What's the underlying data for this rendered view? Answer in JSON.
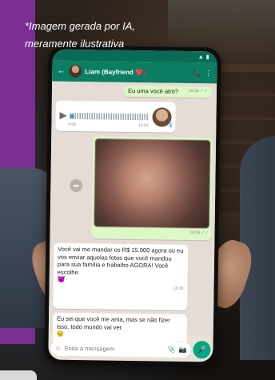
{
  "caption": {
    "line1": "*Imagem gerada por IA,",
    "line2": "meramente ilustrativa"
  },
  "phone": {
    "contact_name": "Liam (Bayfriend",
    "contact_heart": "❤️)",
    "messages": {
      "m1_text": "Eu uma você atro?",
      "m1_time": "19:33",
      "voice_elapsed": "0:00",
      "voice_total": "12:44",
      "photo_time": "19:38",
      "m4_text": "Você vai me mandar os R$ 15.000 agora ou eu vos enviar aquelas fotos que você mandou para sua família e trabalho AGORA! Você escolhe.",
      "m4_time": "10:35",
      "m5_text": "Eu sei que você me ama, mas se não fizer isso, todo mundo vai ver.",
      "m5_time": "10:35"
    },
    "input_placeholder": "Enita a mensagem"
  },
  "colors": {
    "purple_band": "#7b2f93",
    "whatsapp_header": "#0a7d63",
    "outgoing_bubble": "#dcf8c6",
    "send_mic": "#00a884"
  },
  "icons": [
    "back-arrow-icon",
    "video-call-icon",
    "more-menu-icon",
    "play-icon",
    "mic-icon",
    "forward-icon",
    "emoji-icon",
    "attach-icon",
    "camera-icon",
    "devil-emoji-icon",
    "worried-emoji-icon",
    "signal-icon",
    "battery-icon"
  ]
}
